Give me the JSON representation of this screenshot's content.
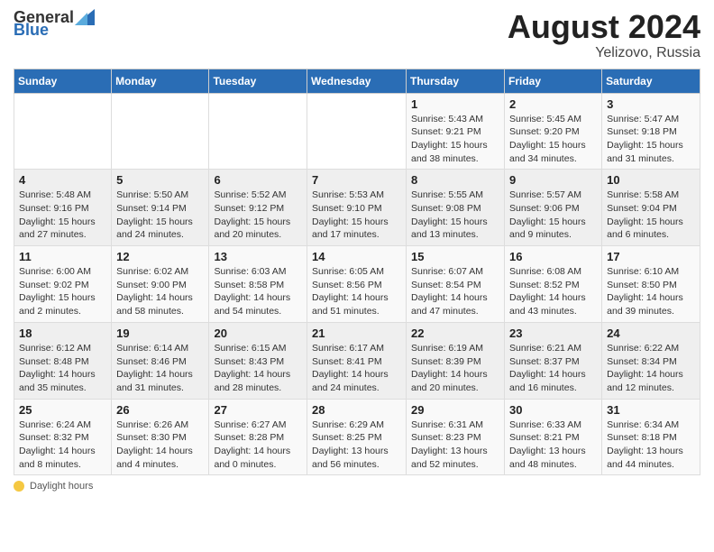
{
  "header": {
    "logo_general": "General",
    "logo_blue": "Blue",
    "title": "August 2024",
    "location": "Yelizovo, Russia"
  },
  "weekdays": [
    "Sunday",
    "Monday",
    "Tuesday",
    "Wednesday",
    "Thursday",
    "Friday",
    "Saturday"
  ],
  "weeks": [
    [
      {
        "day": "",
        "info": ""
      },
      {
        "day": "",
        "info": ""
      },
      {
        "day": "",
        "info": ""
      },
      {
        "day": "",
        "info": ""
      },
      {
        "day": "1",
        "info": "Sunrise: 5:43 AM\nSunset: 9:21 PM\nDaylight: 15 hours and 38 minutes."
      },
      {
        "day": "2",
        "info": "Sunrise: 5:45 AM\nSunset: 9:20 PM\nDaylight: 15 hours and 34 minutes."
      },
      {
        "day": "3",
        "info": "Sunrise: 5:47 AM\nSunset: 9:18 PM\nDaylight: 15 hours and 31 minutes."
      }
    ],
    [
      {
        "day": "4",
        "info": "Sunrise: 5:48 AM\nSunset: 9:16 PM\nDaylight: 15 hours and 27 minutes."
      },
      {
        "day": "5",
        "info": "Sunrise: 5:50 AM\nSunset: 9:14 PM\nDaylight: 15 hours and 24 minutes."
      },
      {
        "day": "6",
        "info": "Sunrise: 5:52 AM\nSunset: 9:12 PM\nDaylight: 15 hours and 20 minutes."
      },
      {
        "day": "7",
        "info": "Sunrise: 5:53 AM\nSunset: 9:10 PM\nDaylight: 15 hours and 17 minutes."
      },
      {
        "day": "8",
        "info": "Sunrise: 5:55 AM\nSunset: 9:08 PM\nDaylight: 15 hours and 13 minutes."
      },
      {
        "day": "9",
        "info": "Sunrise: 5:57 AM\nSunset: 9:06 PM\nDaylight: 15 hours and 9 minutes."
      },
      {
        "day": "10",
        "info": "Sunrise: 5:58 AM\nSunset: 9:04 PM\nDaylight: 15 hours and 6 minutes."
      }
    ],
    [
      {
        "day": "11",
        "info": "Sunrise: 6:00 AM\nSunset: 9:02 PM\nDaylight: 15 hours and 2 minutes."
      },
      {
        "day": "12",
        "info": "Sunrise: 6:02 AM\nSunset: 9:00 PM\nDaylight: 14 hours and 58 minutes."
      },
      {
        "day": "13",
        "info": "Sunrise: 6:03 AM\nSunset: 8:58 PM\nDaylight: 14 hours and 54 minutes."
      },
      {
        "day": "14",
        "info": "Sunrise: 6:05 AM\nSunset: 8:56 PM\nDaylight: 14 hours and 51 minutes."
      },
      {
        "day": "15",
        "info": "Sunrise: 6:07 AM\nSunset: 8:54 PM\nDaylight: 14 hours and 47 minutes."
      },
      {
        "day": "16",
        "info": "Sunrise: 6:08 AM\nSunset: 8:52 PM\nDaylight: 14 hours and 43 minutes."
      },
      {
        "day": "17",
        "info": "Sunrise: 6:10 AM\nSunset: 8:50 PM\nDaylight: 14 hours and 39 minutes."
      }
    ],
    [
      {
        "day": "18",
        "info": "Sunrise: 6:12 AM\nSunset: 8:48 PM\nDaylight: 14 hours and 35 minutes."
      },
      {
        "day": "19",
        "info": "Sunrise: 6:14 AM\nSunset: 8:46 PM\nDaylight: 14 hours and 31 minutes."
      },
      {
        "day": "20",
        "info": "Sunrise: 6:15 AM\nSunset: 8:43 PM\nDaylight: 14 hours and 28 minutes."
      },
      {
        "day": "21",
        "info": "Sunrise: 6:17 AM\nSunset: 8:41 PM\nDaylight: 14 hours and 24 minutes."
      },
      {
        "day": "22",
        "info": "Sunrise: 6:19 AM\nSunset: 8:39 PM\nDaylight: 14 hours and 20 minutes."
      },
      {
        "day": "23",
        "info": "Sunrise: 6:21 AM\nSunset: 8:37 PM\nDaylight: 14 hours and 16 minutes."
      },
      {
        "day": "24",
        "info": "Sunrise: 6:22 AM\nSunset: 8:34 PM\nDaylight: 14 hours and 12 minutes."
      }
    ],
    [
      {
        "day": "25",
        "info": "Sunrise: 6:24 AM\nSunset: 8:32 PM\nDaylight: 14 hours and 8 minutes."
      },
      {
        "day": "26",
        "info": "Sunrise: 6:26 AM\nSunset: 8:30 PM\nDaylight: 14 hours and 4 minutes."
      },
      {
        "day": "27",
        "info": "Sunrise: 6:27 AM\nSunset: 8:28 PM\nDaylight: 14 hours and 0 minutes."
      },
      {
        "day": "28",
        "info": "Sunrise: 6:29 AM\nSunset: 8:25 PM\nDaylight: 13 hours and 56 minutes."
      },
      {
        "day": "29",
        "info": "Sunrise: 6:31 AM\nSunset: 8:23 PM\nDaylight: 13 hours and 52 minutes."
      },
      {
        "day": "30",
        "info": "Sunrise: 6:33 AM\nSunset: 8:21 PM\nDaylight: 13 hours and 48 minutes."
      },
      {
        "day": "31",
        "info": "Sunrise: 6:34 AM\nSunset: 8:18 PM\nDaylight: 13 hours and 44 minutes."
      }
    ]
  ],
  "footer": {
    "daylight_label": "Daylight hours"
  }
}
